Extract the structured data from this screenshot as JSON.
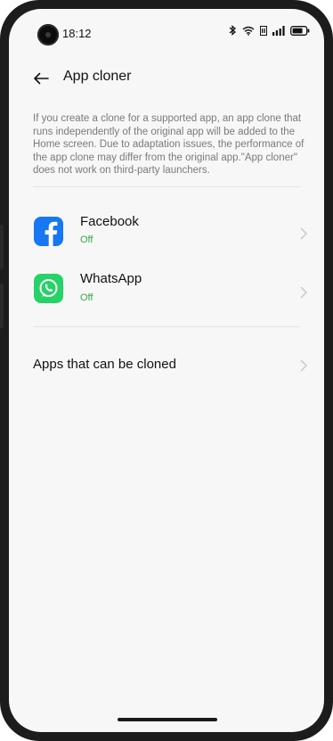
{
  "status_bar": {
    "time": "18:12",
    "icons": [
      "bluetooth-icon",
      "wifi-icon",
      "hd-icon",
      "signal-icon",
      "battery-icon"
    ]
  },
  "header": {
    "back_icon": "arrow-left-icon",
    "title": "App cloner"
  },
  "description": "If you create a clone for a supported app, an app clone that runs independently of the original app will be added to the Home screen. Due to adaptation issues, the performance of the app clone may differ from the original app.\"App cloner\" does not work on third-party launchers.",
  "apps": [
    {
      "name": "Facebook",
      "state": "Off",
      "icon": "facebook-icon",
      "color": "#1877F2"
    },
    {
      "name": "WhatsApp",
      "state": "Off",
      "icon": "whatsapp-icon",
      "color": "#25D366"
    }
  ],
  "cloneable": {
    "label": "Apps that can be cloned",
    "icon": "chevron-right-icon"
  },
  "colors": {
    "background": "#f7f7f7",
    "state_off": "#3aa64a",
    "description_text": "#7a7a7a"
  }
}
